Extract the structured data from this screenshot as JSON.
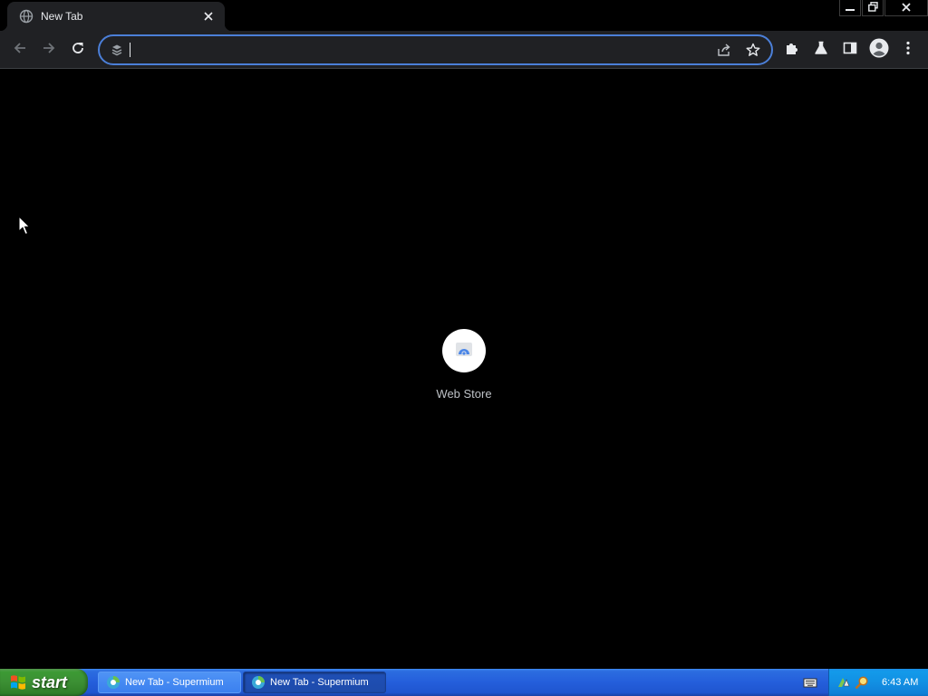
{
  "browser": {
    "tab": {
      "title": "New Tab",
      "favicon": "globe-icon",
      "close_icon": "close-icon"
    },
    "window_controls": [
      "minimize-icon",
      "restore-icon",
      "close-icon"
    ],
    "toolbar": {
      "back_icon": "arrow-left-icon",
      "forward_icon": "arrow-right-icon",
      "reload_icon": "reload-icon",
      "address_value": "",
      "address_placeholder": "",
      "omnibox_icons": [
        "share-icon",
        "star-icon"
      ],
      "right_icons": [
        "puzzle-icon",
        "flask-icon",
        "side-panel-icon",
        "profile-icon",
        "kebab-menu-icon"
      ]
    },
    "accent_color": "#4b7fd8"
  },
  "new_tab_page": {
    "shortcuts": [
      {
        "label": "Web Store",
        "icon": "web-store-icon"
      }
    ]
  },
  "taskbar": {
    "start_label": "start",
    "tasks": [
      {
        "label": "New Tab - Supermium",
        "active": false
      },
      {
        "label": "New Tab - Supermium",
        "active": true
      }
    ],
    "tray_icons": [
      "keyboard-icon",
      "network-icon",
      "search-icon"
    ],
    "clock": "6:43 AM"
  }
}
